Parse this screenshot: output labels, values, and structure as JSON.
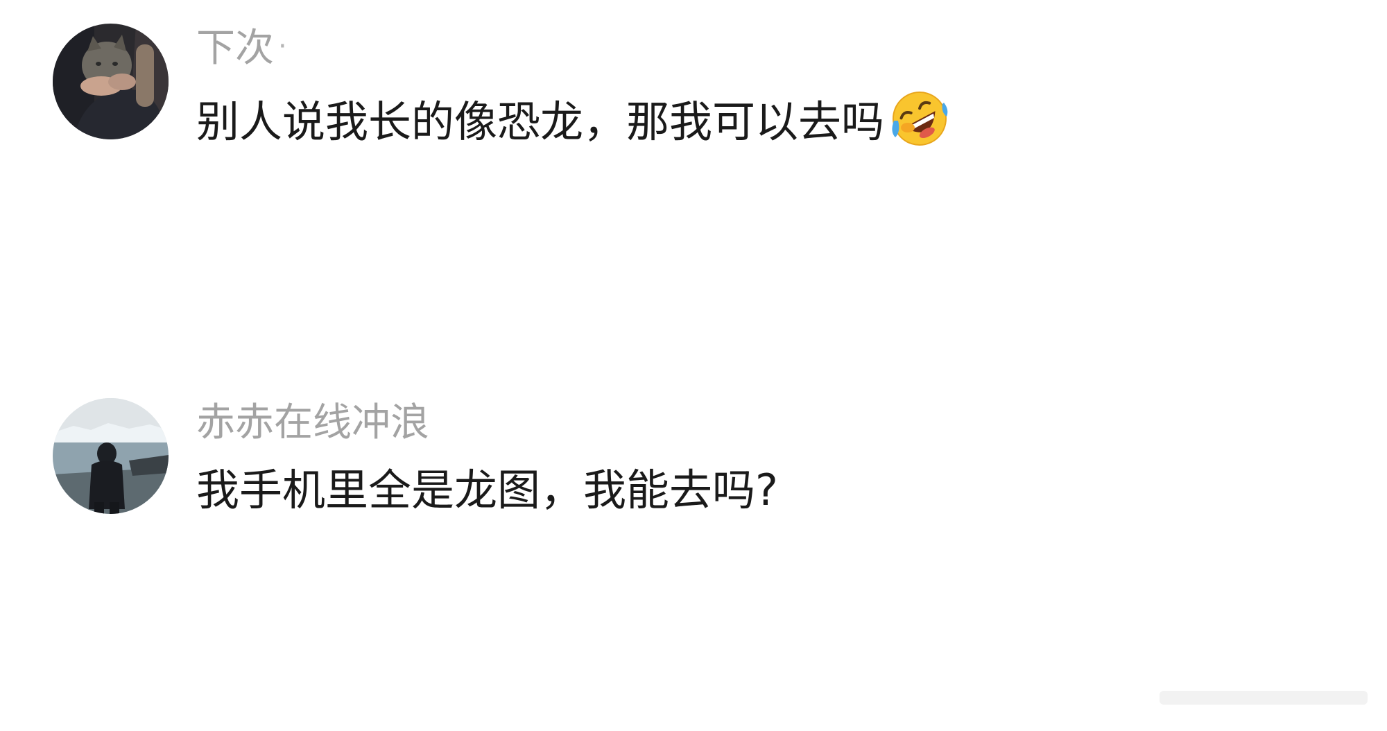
{
  "comments": [
    {
      "username": "下次",
      "username_suffix": "·",
      "text": "别人说我长的像恐龙，那我可以去吗",
      "emoji": "rolling-on-floor-laughing-icon",
      "avatar": "avatar-person-holding-cat"
    },
    {
      "username": "赤赤在线冲浪",
      "text": "我手机里全是龙图，我能去吗?",
      "avatar": "avatar-person-by-glacier-lake"
    }
  ],
  "colors": {
    "background": "#ffffff",
    "username": "#a3a3a3",
    "text": "#1a1a1a"
  }
}
